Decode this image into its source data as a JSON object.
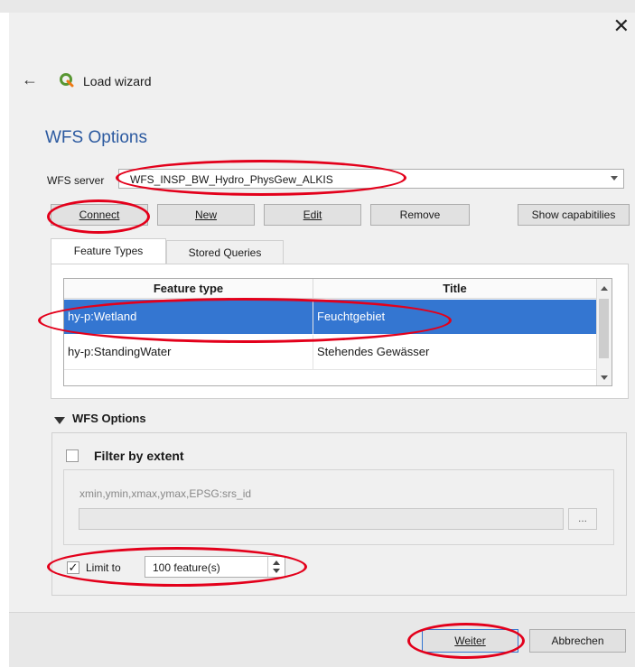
{
  "window": {
    "title": "Load wizard"
  },
  "page": {
    "heading": "WFS Options"
  },
  "server": {
    "label": "WFS server",
    "value": "WFS_INSP_BW_Hydro_PhysGew_ALKIS"
  },
  "buttons": {
    "connect": "Connect",
    "new": "New",
    "edit": "Edit",
    "remove": "Remove",
    "show_capabilities": "Show capabitilies"
  },
  "tabs": [
    "Feature Types",
    "Stored Queries"
  ],
  "table": {
    "headers": [
      "Feature type",
      "Title"
    ],
    "rows": [
      {
        "type": "hy-p:Wetland",
        "title": "Feuchtgebiet",
        "selected": true
      },
      {
        "type": "hy-p:StandingWater",
        "title": "Stehendes Gewässer",
        "selected": false
      }
    ]
  },
  "options": {
    "section_label": "WFS Options",
    "filter_label": "Filter by extent",
    "filter_checked": false,
    "extent_placeholder": "xmin,ymin,xmax,ymax,EPSG:srs_id",
    "extent_value": "",
    "browse_label": "...",
    "limit_label": "Limit to",
    "limit_checked": true,
    "limit_value": "100 feature(s)"
  },
  "footer": {
    "next": "Weiter",
    "cancel": "Abbrechen"
  },
  "colors": {
    "accent": "#2c5aa0",
    "selection": "#3476d1",
    "annotation": "#e3001b"
  },
  "icons": {
    "back": "arrow-left-icon",
    "logo": "qgis-logo-icon",
    "close": "close-icon"
  }
}
